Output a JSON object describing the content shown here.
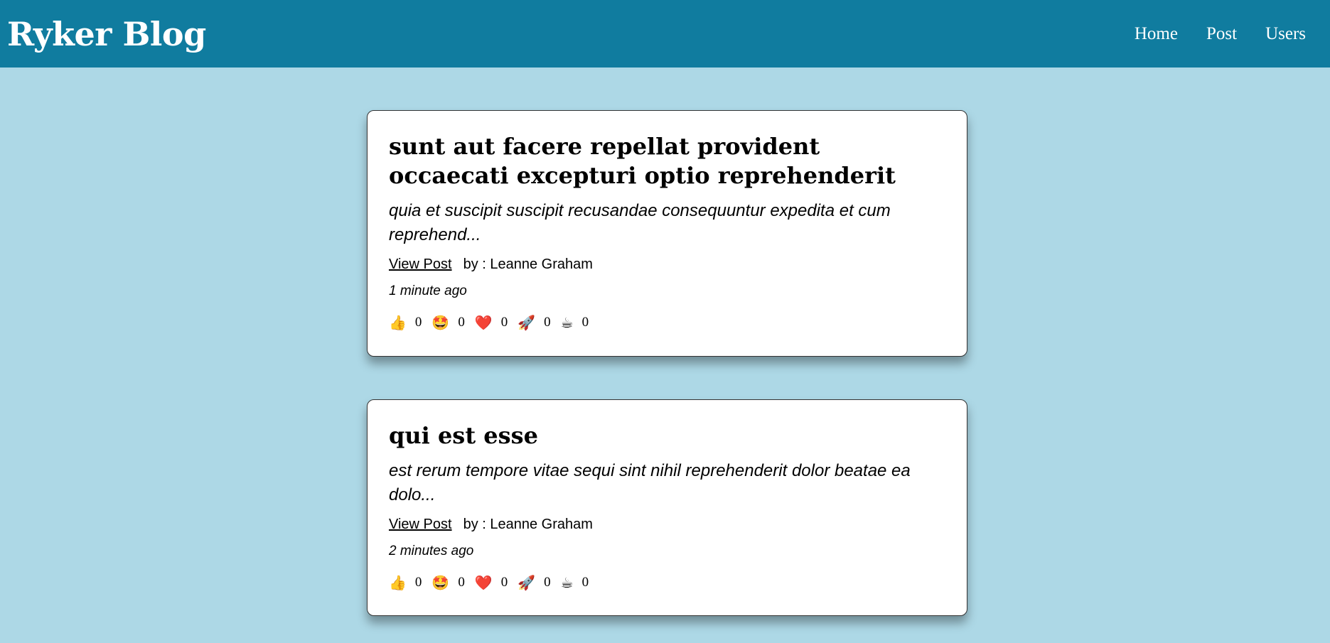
{
  "header": {
    "title": "Ryker Blog",
    "nav": {
      "home": "Home",
      "post": "Post",
      "users": "Users"
    }
  },
  "posts": [
    {
      "title": "sunt aut facere repellat provident occaecati excepturi optio reprehenderit",
      "excerpt": "quia et suscipit suscipit recusandae consequuntur expedita et cum reprehend...",
      "view_label": "View Post",
      "author": "by : Leanne Graham",
      "time": "1 minute ago",
      "reactions": [
        {
          "icon": "thumbs-up-icon",
          "glyph": "👍",
          "count": "0"
        },
        {
          "icon": "star-struck-icon",
          "glyph": "🤩",
          "count": "0"
        },
        {
          "icon": "heart-icon",
          "glyph": "❤️",
          "count": "0"
        },
        {
          "icon": "rocket-icon",
          "glyph": "🚀",
          "count": "0"
        },
        {
          "icon": "coffee-icon",
          "glyph": "☕",
          "count": "0"
        }
      ]
    },
    {
      "title": "qui est esse",
      "excerpt": "est rerum tempore vitae sequi sint nihil reprehenderit dolor beatae ea dolo...",
      "view_label": "View Post",
      "author": "by : Leanne Graham",
      "time": "2 minutes ago",
      "reactions": [
        {
          "icon": "thumbs-up-icon",
          "glyph": "👍",
          "count": "0"
        },
        {
          "icon": "star-struck-icon",
          "glyph": "🤩",
          "count": "0"
        },
        {
          "icon": "heart-icon",
          "glyph": "❤️",
          "count": "0"
        },
        {
          "icon": "rocket-icon",
          "glyph": "🚀",
          "count": "0"
        },
        {
          "icon": "coffee-icon",
          "glyph": "☕",
          "count": "0"
        }
      ]
    }
  ]
}
